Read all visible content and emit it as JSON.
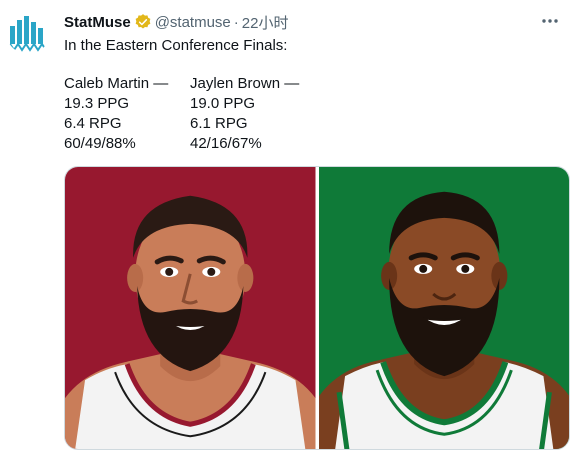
{
  "tweet": {
    "author_name": "StatMuse",
    "handle": "@statmuse",
    "separator": "·",
    "time": "22小时",
    "intro": "In the Eastern Conference Finals:",
    "players": [
      {
        "name": "Caleb Martin —",
        "ppg": "19.3 PPG",
        "rpg": "6.4 RPG",
        "shooting": "60/49/88%"
      },
      {
        "name": "Jaylen Brown —",
        "ppg": "19.0 PPG",
        "rpg": "6.1 RPG",
        "shooting": "42/16/67%"
      }
    ]
  },
  "colors": {
    "heat_bg": "#97182f",
    "celtics_bg": "#0f7a38",
    "verified_gold": "#e2b719",
    "avatar_blue": "#2aa5c7"
  },
  "icons": {
    "avatar": "statmuse-logo-icon",
    "verified": "verified-badge-icon",
    "more": "more-options-icon"
  }
}
